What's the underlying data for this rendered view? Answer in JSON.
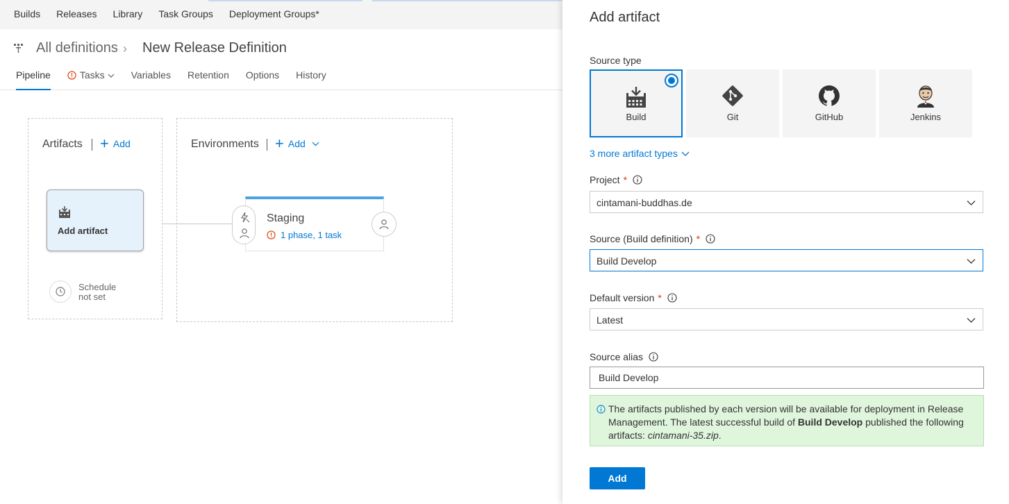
{
  "topnav": {
    "items": [
      "Builds",
      "Releases",
      "Library",
      "Task Groups",
      "Deployment Groups*"
    ]
  },
  "header": {
    "breadcrumb_root": "All definitions",
    "breadcrumb_sep": "›",
    "title": "New Release Definition",
    "tabs": {
      "pipeline": "Pipeline",
      "tasks": "Tasks",
      "variables": "Variables",
      "retention": "Retention",
      "options": "Options",
      "history": "History"
    }
  },
  "pipeline": {
    "artifacts_title": "Artifacts",
    "artifacts_add": "Add",
    "artifact_card_label": "Add artifact",
    "schedule_line1": "Schedule",
    "schedule_line2": "not set",
    "environments_title": "Environments",
    "environments_add": "Add",
    "env_name": "Staging",
    "env_status": "1 phase, 1 task"
  },
  "panel": {
    "title": "Add artifact",
    "source_type_label": "Source type",
    "source_types": {
      "build": "Build",
      "git": "Git",
      "github": "GitHub",
      "jenkins": "Jenkins"
    },
    "selected_source_type": "Build",
    "more_types": "3 more artifact types",
    "project_label": "Project",
    "project_value": "cintamani-buddhas.de",
    "source_label": "Source (Build definition)",
    "source_value": "Build Develop",
    "version_label": "Default version",
    "version_value": "Latest",
    "alias_label": "Source alias",
    "alias_value": "Build Develop",
    "required_mark": "*",
    "info": {
      "part1": "The artifacts published by each version will be available for deployment in Release Management. The latest successful build of ",
      "bold": "Build Develop",
      "part2": " published the following artifacts: ",
      "italic": "cintamani-35.zip",
      "part3": "."
    },
    "add_button": "Add"
  },
  "colors": {
    "accent": "#0078d4",
    "info_bg": "#dff6dd",
    "env_bar": "#4ba3e0",
    "error": "#d83b01"
  }
}
